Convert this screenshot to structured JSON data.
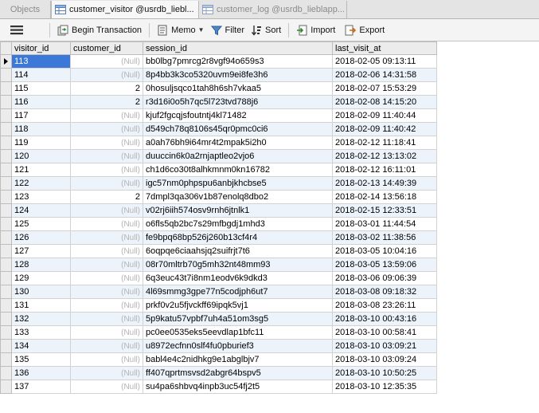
{
  "tabs": [
    {
      "label": "Objects",
      "active": false,
      "icon": "objects"
    },
    {
      "label": "customer_visitor @usrdb_liebl...",
      "active": true,
      "icon": "table-icon"
    },
    {
      "label": "customer_log @usrdb_lieblapp...",
      "active": false,
      "icon": "table-icon"
    }
  ],
  "toolbar": {
    "menu_icon": "hamburger-icon",
    "begin_transaction": "Begin Transaction",
    "memo": "Memo",
    "filter": "Filter",
    "sort": "Sort",
    "import": "Import",
    "export": "Export"
  },
  "columns": [
    "visitor_id",
    "customer_id",
    "session_id",
    "last_visit_at"
  ],
  "null_text": "(Null)",
  "rows": [
    {
      "visitor_id": "113",
      "customer_id": null,
      "session_id": "bb0lbg7pmrcg2r8vgf94o659s3",
      "last_visit_at": "2018-02-05 09:13:11"
    },
    {
      "visitor_id": "114",
      "customer_id": null,
      "session_id": "8p4bb3k3co5320uvm9ei8fe3h6",
      "last_visit_at": "2018-02-06 14:31:58"
    },
    {
      "visitor_id": "115",
      "customer_id": "2",
      "session_id": "0hosuljsqco1tah8h6sh7vkaa5",
      "last_visit_at": "2018-02-07 15:53:29"
    },
    {
      "visitor_id": "116",
      "customer_id": "2",
      "session_id": "r3d16i0o5h7qc5l723tvd788j6",
      "last_visit_at": "2018-02-08 14:15:20"
    },
    {
      "visitor_id": "117",
      "customer_id": null,
      "session_id": "kjuf2fgcqjsfoutntj4kl71482",
      "last_visit_at": "2018-02-09 11:40:44"
    },
    {
      "visitor_id": "118",
      "customer_id": null,
      "session_id": "d549ch78q8106s45qr0pmc0ci6",
      "last_visit_at": "2018-02-09 11:40:42"
    },
    {
      "visitor_id": "119",
      "customer_id": null,
      "session_id": "a0ah76bh9i64mr4t2mpak5i2h0",
      "last_visit_at": "2018-02-12 11:18:41"
    },
    {
      "visitor_id": "120",
      "customer_id": null,
      "session_id": "duuccin6k0a2rnjaptleo2vjo6",
      "last_visit_at": "2018-02-12 13:13:02"
    },
    {
      "visitor_id": "121",
      "customer_id": null,
      "session_id": "ch1d6co30t8alhkmnm0kn16782",
      "last_visit_at": "2018-02-12 16:11:01"
    },
    {
      "visitor_id": "122",
      "customer_id": null,
      "session_id": "igc57nm0phpspu6anbjkhcbse5",
      "last_visit_at": "2018-02-13 14:49:39"
    },
    {
      "visitor_id": "123",
      "customer_id": "2",
      "session_id": "7dmpl3qa306v1b87enolq8dbo2",
      "last_visit_at": "2018-02-14 13:56:18"
    },
    {
      "visitor_id": "124",
      "customer_id": null,
      "session_id": "v02rj6iih574osv9rnh6jtnlk1",
      "last_visit_at": "2018-02-15 12:33:51"
    },
    {
      "visitor_id": "125",
      "customer_id": null,
      "session_id": "o6fls5qb2bc7s29mfbgdj1mhd3",
      "last_visit_at": "2018-03-01 11:44:54"
    },
    {
      "visitor_id": "126",
      "customer_id": null,
      "session_id": "fe9bpq68bp526j260b13cf4r4",
      "last_visit_at": "2018-03-02 11:38:56"
    },
    {
      "visitor_id": "127",
      "customer_id": null,
      "session_id": "6oqpqe6ciaahsjq2suifrjt7t6",
      "last_visit_at": "2018-03-05 10:04:16"
    },
    {
      "visitor_id": "128",
      "customer_id": null,
      "session_id": "08r70mltrb70g5mh32nt48mm93",
      "last_visit_at": "2018-03-05 13:59:06"
    },
    {
      "visitor_id": "129",
      "customer_id": null,
      "session_id": "6q3euc43t7i8nm1eodv6k9dkd3",
      "last_visit_at": "2018-03-06 09:06:39"
    },
    {
      "visitor_id": "130",
      "customer_id": null,
      "session_id": "4l69smmg3gpe77n5codjph6ut7",
      "last_visit_at": "2018-03-08 09:18:32"
    },
    {
      "visitor_id": "131",
      "customer_id": null,
      "session_id": "prkf0v2u5fjvckff69ipqk5vj1",
      "last_visit_at": "2018-03-08 23:26:11"
    },
    {
      "visitor_id": "132",
      "customer_id": null,
      "session_id": "5p9katu57vpbf7uh4a51om3sg5",
      "last_visit_at": "2018-03-10 00:43:16"
    },
    {
      "visitor_id": "133",
      "customer_id": null,
      "session_id": "pc0ee0535eks5eevdlap1bfc11",
      "last_visit_at": "2018-03-10 00:58:41"
    },
    {
      "visitor_id": "134",
      "customer_id": null,
      "session_id": "u8972ecfnn0slf4fu0pburief3",
      "last_visit_at": "2018-03-10 03:09:21"
    },
    {
      "visitor_id": "135",
      "customer_id": null,
      "session_id": "babl4e4c2nidhkg9e1abglbjv7",
      "last_visit_at": "2018-03-10 03:09:24"
    },
    {
      "visitor_id": "136",
      "customer_id": null,
      "session_id": "ff407qprtmsvsd2abgr64bspv5",
      "last_visit_at": "2018-03-10 10:50:25"
    },
    {
      "visitor_id": "137",
      "customer_id": null,
      "session_id": "su4pa6shbvq4inpb3uc54fj2t5",
      "last_visit_at": "2018-03-10 12:35:35"
    }
  ],
  "colors": {
    "selected_cell": "#3b78d8",
    "alt_row": "#edf3fb",
    "null_text": "#b3b3b3"
  }
}
